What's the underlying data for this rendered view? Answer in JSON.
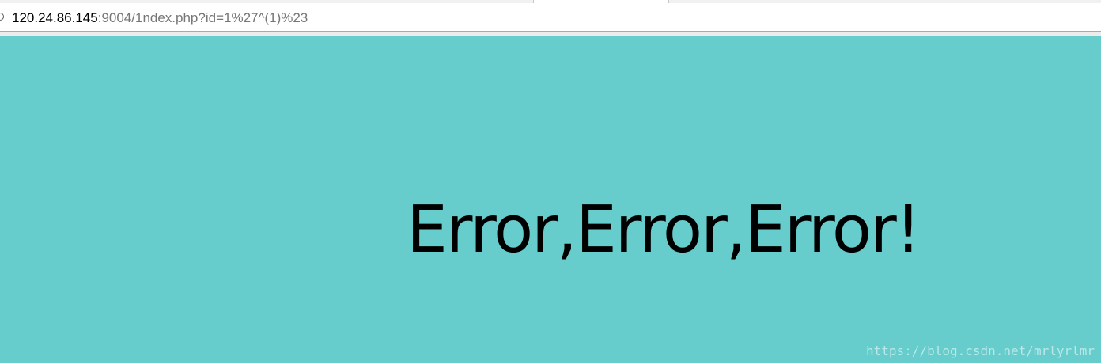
{
  "browser": {
    "address_bar": {
      "host": "120.24.86.145",
      "path_and_query": ":9004/1ndex.php?id=1%27^(1)%23",
      "icon": "info-icon"
    }
  },
  "page": {
    "background_color": "#66cccc",
    "error_message": "Error,Error,Error!",
    "watermark": "https://blog.csdn.net/mrlyrlmr"
  }
}
